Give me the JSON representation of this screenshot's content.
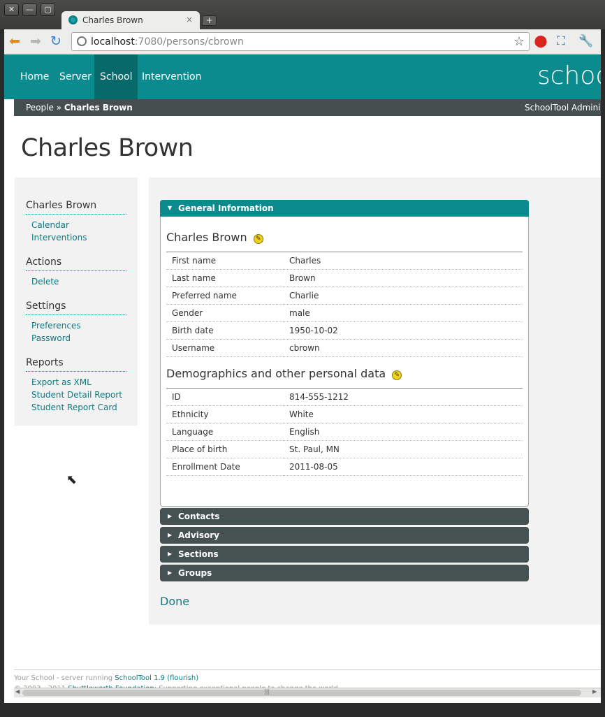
{
  "window": {
    "close": "✕",
    "minimize": "—",
    "maximize": "▢"
  },
  "tab": {
    "title": "Charles Brown",
    "close": "×",
    "new_tab": "+"
  },
  "toolbar": {
    "url_host": "localhost",
    "url_rest": ":7080/persons/cbrown"
  },
  "header": {
    "nav": [
      "Home",
      "Server",
      "School",
      "Intervention"
    ],
    "active_nav": "School",
    "brand": "schoo"
  },
  "breadcrumb": {
    "root": "People",
    "separator": "»",
    "current": "Charles Brown",
    "user": "SchoolTool Administ"
  },
  "page_title": "Charles Brown",
  "sidebar": {
    "groups": [
      {
        "title": "Charles Brown",
        "links": [
          "Calendar",
          "Interventions"
        ]
      },
      {
        "title": "Actions",
        "links": [
          "Delete"
        ]
      },
      {
        "title": "Settings",
        "links": [
          "Preferences",
          "Password"
        ]
      },
      {
        "title": "Reports",
        "links": [
          "Export as XML",
          "Student Detail Report",
          "Student Report Card"
        ]
      }
    ]
  },
  "general": {
    "header": "General Information",
    "person_title": "Charles Brown",
    "rows": [
      {
        "label": "First name",
        "value": "Charles"
      },
      {
        "label": "Last name",
        "value": "Brown"
      },
      {
        "label": "Preferred name",
        "value": "Charlie"
      },
      {
        "label": "Gender",
        "value": "male"
      },
      {
        "label": "Birth date",
        "value": "1950-10-02"
      },
      {
        "label": "Username",
        "value": "cbrown"
      }
    ],
    "demo_title": "Demographics and other personal data",
    "demo_rows": [
      {
        "label": "ID",
        "value": "814-555-1212"
      },
      {
        "label": "Ethnicity",
        "value": "White"
      },
      {
        "label": "Language",
        "value": "English"
      },
      {
        "label": "Place of birth",
        "value": "St. Paul, MN"
      },
      {
        "label": "Enrollment Date",
        "value": "2011-08-05"
      }
    ]
  },
  "collapsed_panels": [
    "Contacts",
    "Advisory",
    "Sections",
    "Groups"
  ],
  "done_label": "Done",
  "footer": {
    "line1_prefix": "Your School - server running ",
    "line1_link": "SchoolTool 1.9 (flourish)",
    "line2_prefix": "© 2003 - 2011 ",
    "line2_link": "Shuttleworth Foundation",
    "line2_suffix": ": Supporting exceptional people to change the world."
  },
  "colors": {
    "teal": "#0c8b8e",
    "dark_teal": "#08696b",
    "dark_panel": "#465252",
    "link": "#0c7a80"
  }
}
